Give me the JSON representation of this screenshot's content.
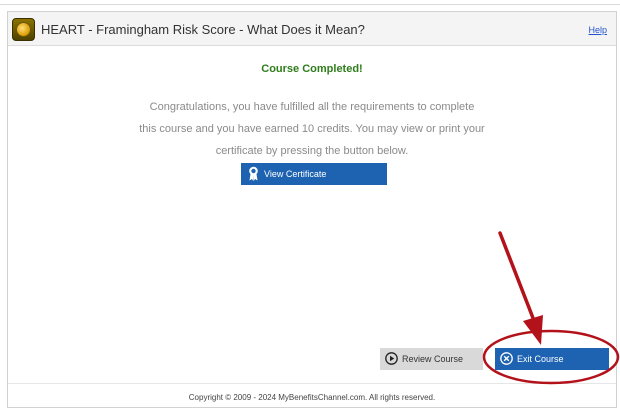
{
  "window": {
    "title": "HEART - Framingham Risk Score - What Does it Mean?",
    "help_label": "Help"
  },
  "main": {
    "heading": "Course Completed!",
    "message_lines": [
      "Congratulations, you have fulfilled all the requirements to complete",
      "this course and you have earned 10 credits. You may view or print your",
      "certificate by pressing the button below."
    ],
    "view_certificate_label": "View Certificate"
  },
  "actions": {
    "review_label": "Review Course",
    "exit_label": "Exit Course"
  },
  "footer": {
    "copyright": "Copyright © 2009 - 2024 MyBenefitsChannel.com. All rights reserved."
  },
  "colors": {
    "accent_blue": "#1d63b1",
    "heading_green": "#2e7d1a",
    "annotation_red": "#b3121b"
  },
  "icons": {
    "app": "app-logo-icon",
    "certificate": "ribbon-award-icon",
    "review": "play-circle-icon",
    "exit": "close-circle-icon"
  }
}
